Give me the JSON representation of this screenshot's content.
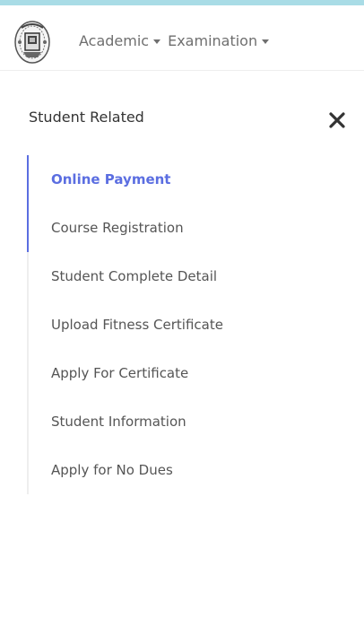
{
  "theme": {
    "accent": "#5b6ee1",
    "topbar": "#a9dce6",
    "text": "#555555"
  },
  "header": {
    "logo_icon": "institute-emblem-icon",
    "menus": [
      {
        "label": "Academic",
        "icon": "caret-down-icon"
      },
      {
        "label": "Examination",
        "icon": "caret-down-icon"
      }
    ]
  },
  "sidebar": {
    "title": "Student Related",
    "close_icon": "close-icon",
    "items": [
      {
        "label": "Online Payment",
        "active": true
      },
      {
        "label": "Course Registration"
      },
      {
        "label": "Student Complete Detail"
      },
      {
        "label": "Upload Fitness Certificate"
      },
      {
        "label": "Apply For Certificate"
      },
      {
        "label": "Student Information"
      },
      {
        "label": "Apply for No Dues"
      }
    ]
  }
}
